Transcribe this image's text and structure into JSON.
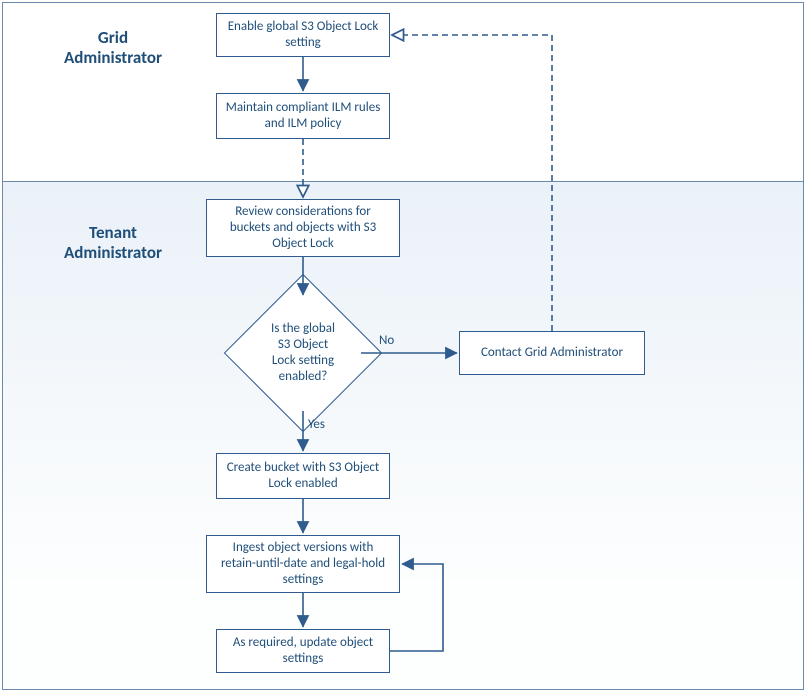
{
  "roles": {
    "grid_admin": "Grid\nAdministrator",
    "tenant_admin": "Tenant\nAdministrator"
  },
  "nodes": {
    "enable_global": "Enable global S3 Object Lock setting",
    "maintain_ilm": "Maintain compliant ILM rules and ILM policy",
    "review": "Review considerations for buckets and objects with S3 Object Lock",
    "decision": "Is the global S3 Object Lock setting enabled?",
    "contact_grid": "Contact Grid Administrator",
    "create_bucket": "Create bucket with S3 Object Lock enabled",
    "ingest": "Ingest object versions with retain-until-date and legal-hold settings",
    "update_settings": "As required, update object settings"
  },
  "edges": {
    "no": "No",
    "yes": "Yes"
  },
  "colors": {
    "stroke": "#2f5b8e",
    "text": "#1f4e79",
    "arrow_fill": "#2f5b8e",
    "arrow_fill_open": "#ffffff"
  }
}
